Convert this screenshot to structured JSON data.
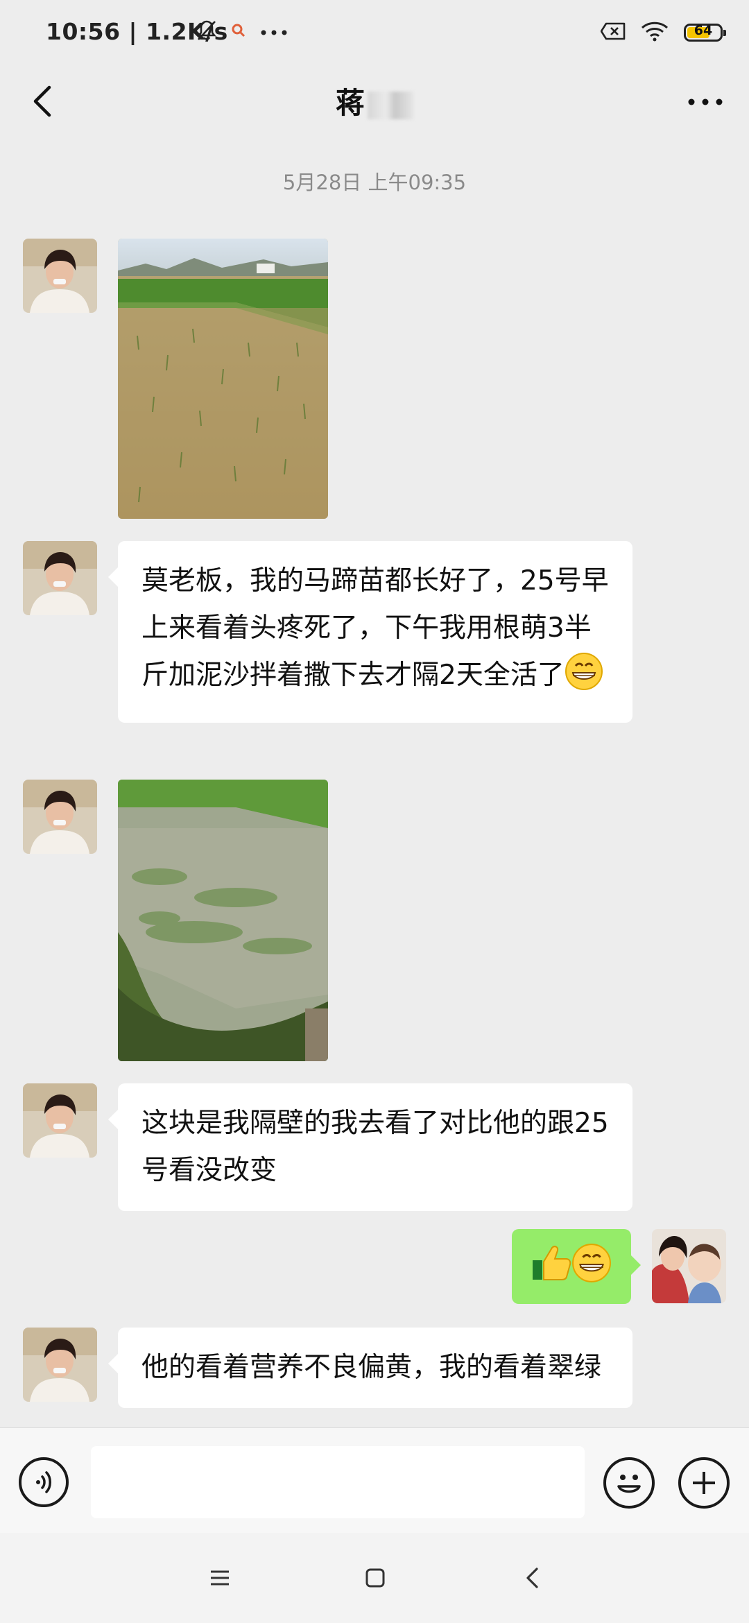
{
  "status_bar": {
    "time": "10:56 | 1.2K/s",
    "battery": "64",
    "colors": {
      "battery_fill": "#f5c400"
    }
  },
  "header": {
    "title": "蒋",
    "back_icon": "chevron-left-icon",
    "more_icon": "more-horizontal-icon"
  },
  "chat": {
    "timestamp": "5月28日 上午09:35",
    "messages": [
      {
        "sender": "contact",
        "kind": "image",
        "alt": "稻田幼苗照片"
      },
      {
        "sender": "contact",
        "kind": "text",
        "text": "莫老板，我的马蹄苗都长好了，25号早上来看着头疼死了，下午我用根萌3半斤加泥沙拌着撒下去才隔2天全活了"
      },
      {
        "sender": "contact",
        "kind": "image",
        "alt": "隔壁田块照片"
      },
      {
        "sender": "contact",
        "kind": "text",
        "text": "这块是我隔壁的我去看了对比他的跟25号看没改变"
      },
      {
        "sender": "me",
        "kind": "emoji",
        "emojis": [
          "thumbs-up-icon",
          "grin-icon"
        ]
      },
      {
        "sender": "contact",
        "kind": "text",
        "text": "他的看着营养不良偏黄，我的看着翠绿"
      }
    ],
    "colors": {
      "my_bubble": "#95ec69",
      "their_bubble": "#ffffff",
      "background": "#ededed"
    }
  },
  "input_bar": {
    "value": "",
    "voice_icon": "voice-icon",
    "emoji_icon": "emoji-icon",
    "plus_icon": "plus-icon"
  },
  "system_nav": {
    "menu_icon": "menu-icon",
    "home_icon": "home-square-icon",
    "back_icon": "back-triangle-icon"
  }
}
